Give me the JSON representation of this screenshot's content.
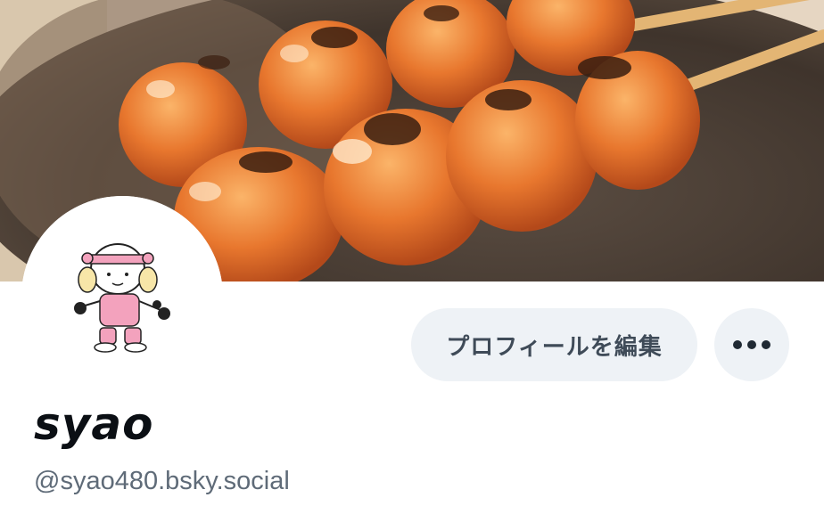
{
  "profile": {
    "display_name": "syao",
    "handle": "@syao480.bsky.social",
    "edit_button_label": "プロフィールを編集",
    "more_icon": "more-horizontal-icon"
  },
  "banner": {
    "subject": "mitarashi-dango-photo"
  },
  "colors": {
    "button_bg": "#eef2f6",
    "button_text": "#3f4b58",
    "handle_text": "#5f6b78",
    "name_text": "#0b0f14"
  }
}
